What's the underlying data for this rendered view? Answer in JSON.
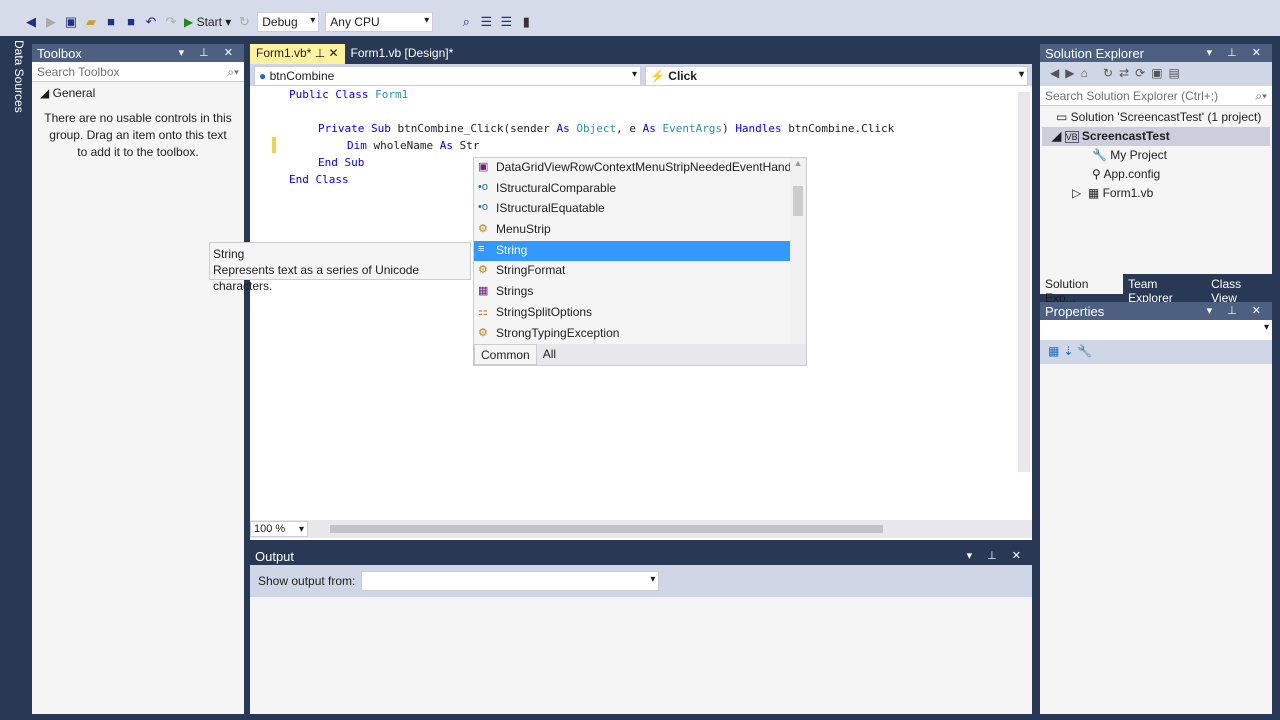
{
  "toolbar": {
    "start": "Start",
    "config": "Debug",
    "platform": "Any CPU"
  },
  "side_strip": "Data Sources",
  "toolbox": {
    "title": "Toolbox",
    "search_placeholder": "Search Toolbox",
    "group": "General",
    "empty": "There are no usable controls in this group. Drag an item onto this text to add it to the toolbox."
  },
  "editor": {
    "tabs": [
      "Form1.vb*",
      "Form1.vb [Design]*"
    ],
    "object": "btnCombine",
    "event": "Click",
    "zoom": "100 %",
    "lines": [
      "Public Class Form1",
      "Private Sub btnCombine_Click(sender As Object, e As EventArgs) Handles btnCombine.Click",
      "Dim wholeName As Str",
      "End Sub",
      "End Class"
    ]
  },
  "completion": {
    "items": [
      "DataGridViewRowContextMenuStripNeededEventHandler",
      "IStructuralComparable",
      "IStructuralEquatable",
      "MenuStrip",
      "String",
      "StringFormat",
      "Strings",
      "StringSplitOptions",
      "StrongTypingException"
    ],
    "selected": 4,
    "tabs": [
      "Common",
      "All"
    ]
  },
  "tooltip": {
    "title": "String",
    "desc": "Represents text as a series of Unicode characters."
  },
  "output": {
    "title": "Output",
    "label": "Show output from:"
  },
  "solution": {
    "title": "Solution Explorer",
    "search_placeholder": "Search Solution Explorer (Ctrl+;)",
    "items": [
      "Solution 'ScreencastTest' (1 project)",
      "ScreencastTest",
      "My Project",
      "App.config",
      "Form1.vb"
    ],
    "tabs": [
      "Solution Exp...",
      "Team Explorer",
      "Class View"
    ]
  },
  "properties": {
    "title": "Properties"
  }
}
